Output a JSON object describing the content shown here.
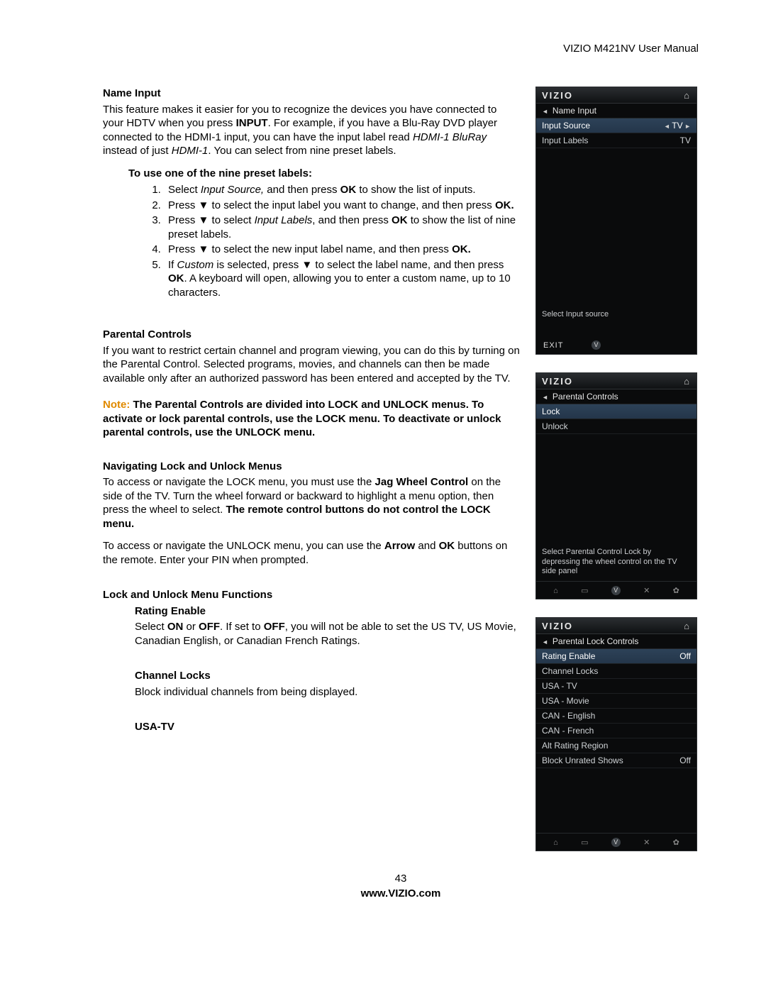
{
  "header": {
    "title": "VIZIO M421NV User Manual"
  },
  "section1": {
    "title": "Name Input",
    "para_parts": {
      "a": "This feature makes it easier for you to recognize the devices you have connected to your HDTV when you press ",
      "b": "INPUT",
      "c": ". For example, if you have a Blu-Ray DVD player connected to the HDMI-1 input, you can have the input label read ",
      "d": "HDMI-1 BluRay",
      "e": " instead of just ",
      "f": "HDMI-1",
      "g": ". You can select from nine preset labels."
    },
    "preset_heading": "To use one of the nine preset labels:",
    "steps": {
      "s1a": "Select ",
      "s1b": "Input Source,",
      "s1c": " and then press ",
      "s1d": "OK",
      "s1e": " to show the list of inputs.",
      "s2a": "Press ▼ to select the input label you want to change, and then press ",
      "s2b": "OK.",
      "s3a": "Press ▼ to select ",
      "s3b": "Input Labels",
      "s3c": ", and then press ",
      "s3d": "OK",
      "s3e": " to show the list of nine preset labels.",
      "s4a": "Press ▼ to select the new input label name, and then press ",
      "s4b": "OK.",
      "s5a": "If ",
      "s5b": "Custom",
      "s5c": " is selected, press ▼ to select the label name, and then press ",
      "s5d": "OK",
      "s5e": ". A keyboard will open, allowing you to enter a custom name, up to 10 characters."
    }
  },
  "section2": {
    "title": "Parental Controls",
    "para": "If you want to restrict certain channel and program viewing, you can do this by turning on the Parental Control. Selected programs, movies, and channels can then be made available only after an authorized password has been entered and accepted by the TV.",
    "note_label": "Note: ",
    "note_body": "The Parental Controls are divided into LOCK and UNLOCK menus. To activate or lock parental controls, use the LOCK menu. To deactivate or unlock parental controls, use the UNLOCK menu."
  },
  "section3": {
    "title": "Navigating Lock and Unlock Menus",
    "p1a": "To access or navigate the LOCK menu, you must use the ",
    "p1b": "Jag Wheel Control",
    "p1c": " on the side of the TV.  Turn the wheel forward or backward to highlight a menu option, then press the wheel to select. ",
    "p1d": "The remote control buttons do not control the LOCK menu.",
    "p2a": "To access or navigate the UNLOCK menu, you can use the ",
    "p2b": "Arrow",
    "p2c": " and ",
    "p2d": "OK",
    "p2e": " buttons on the remote. Enter your PIN when prompted."
  },
  "section4": {
    "title": "Lock and Unlock Menu Functions",
    "rating_title": "Rating Enable",
    "rating_a": "Select ",
    "rating_b": "ON",
    "rating_c": " or ",
    "rating_d": "OFF",
    "rating_e": ". If set to ",
    "rating_f": "OFF",
    "rating_g": ", you will not be able to set the US TV, US Movie, Canadian English, or Canadian French Ratings.",
    "chlocks_title": "Channel Locks",
    "chlocks_body": "Block individual channels from being displayed.",
    "usa_title": "USA-TV"
  },
  "footer": {
    "page": "43",
    "url": "www.VIZIO.com"
  },
  "panel1": {
    "brand": "VIZIO",
    "crumb": "Name Input",
    "row1_l": "Input Source",
    "row1_r": "TV",
    "row2_l": "Input Labels",
    "row2_r": "TV",
    "hint": "Select Input source",
    "exit": "EXIT"
  },
  "panel2": {
    "brand": "VIZIO",
    "crumb": "Parental Controls",
    "row1": "Lock",
    "row2": "Unlock",
    "hint": "Select Parental Control Lock by depressing the wheel control on the TV side panel"
  },
  "panel3": {
    "brand": "VIZIO",
    "crumb": "Parental Lock Controls",
    "rows": [
      {
        "l": "Rating Enable",
        "r": "Off"
      },
      {
        "l": "Channel Locks",
        "r": ""
      },
      {
        "l": "USA - TV",
        "r": ""
      },
      {
        "l": "USA - Movie",
        "r": ""
      },
      {
        "l": "CAN - English",
        "r": ""
      },
      {
        "l": "CAN - French",
        "r": ""
      },
      {
        "l": "Alt Rating Region",
        "r": ""
      },
      {
        "l": "Block Unrated Shows",
        "r": "Off"
      }
    ]
  }
}
